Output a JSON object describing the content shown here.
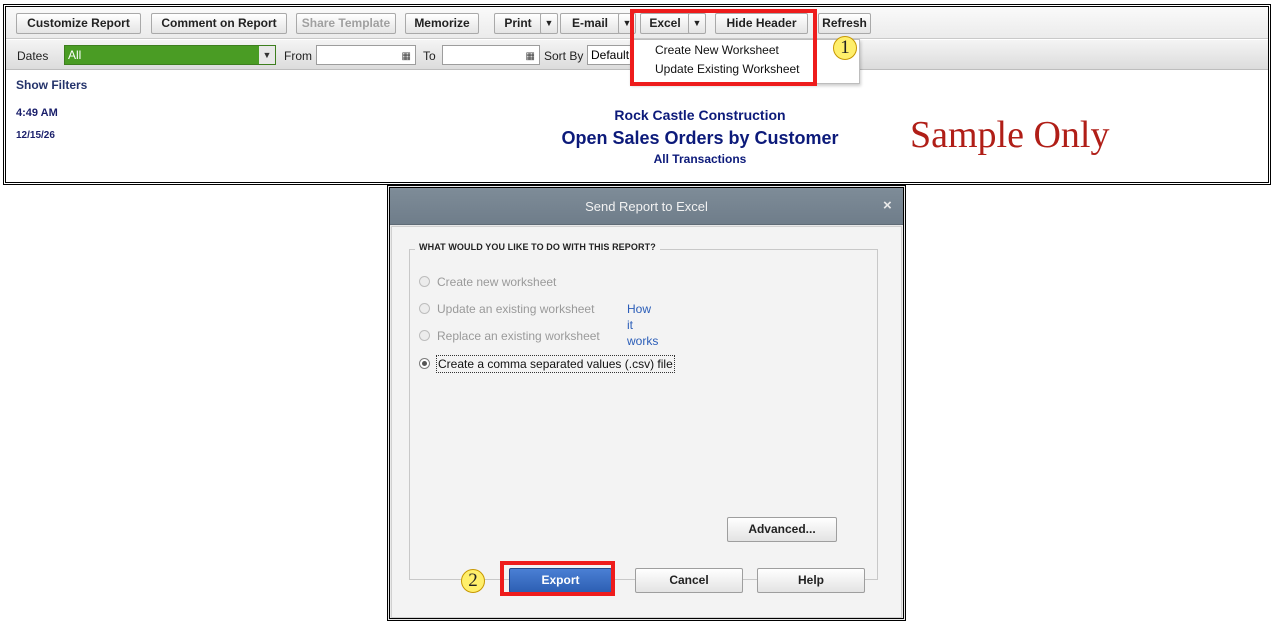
{
  "toolbar": {
    "customize_report": "Customize Report",
    "comment_on_report": "Comment on Report",
    "share_template": "Share Template",
    "memorize": "Memorize",
    "print": "Print",
    "email": "E-mail",
    "excel": "Excel",
    "hide_header": "Hide Header",
    "refresh": "Refresh"
  },
  "filters": {
    "dates_label": "Dates",
    "dates_value": "All",
    "from_label": "From",
    "from_value": "",
    "to_label": "To",
    "to_value": "",
    "sort_by_label": "Sort By",
    "sort_by_value": "Default"
  },
  "show_filters": "Show Filters",
  "report_header": {
    "time": "4:49 AM",
    "date": "12/15/26",
    "company": "Rock Castle Construction",
    "title": "Open Sales Orders by Customer",
    "subtitle": "All Transactions"
  },
  "watermark": "Sample Only",
  "excel_menu": {
    "items": [
      "Create New Worksheet",
      "Update Existing Worksheet"
    ]
  },
  "badges": [
    "1",
    "2"
  ],
  "dialog": {
    "title": "Send Report to Excel",
    "close_glyph": "×",
    "group_title": "WHAT WOULD YOU LIKE TO DO WITH THIS REPORT?",
    "options": [
      {
        "label": "Create new worksheet",
        "enabled": false,
        "selected": false
      },
      {
        "label": "Update an existing worksheet",
        "enabled": false,
        "selected": false
      },
      {
        "label": "Replace an existing worksheet",
        "enabled": false,
        "selected": false
      },
      {
        "label": "Create a comma separated values (.csv) file",
        "enabled": true,
        "selected": true
      }
    ],
    "how_it_works": "How it works",
    "advanced_button": "Advanced...",
    "export_button": "Export",
    "cancel_button": "Cancel",
    "help_button": "Help"
  },
  "colors": {
    "highlight": "#ee1c1c",
    "dates_field": "#4a9c24",
    "report_text": "#0c1a7a",
    "watermark": "#b01e17",
    "export_button": "#2d5fb3"
  }
}
